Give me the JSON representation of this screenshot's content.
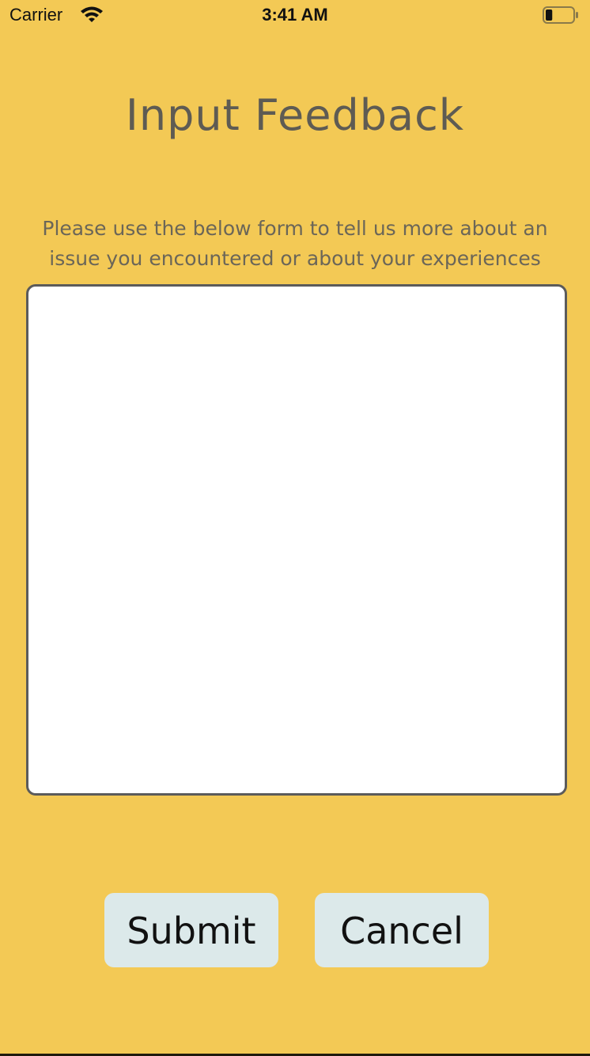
{
  "status_bar": {
    "carrier": "Carrier",
    "time": "3:41 AM",
    "wifi_icon": "wifi-icon",
    "battery_icon": "battery-icon",
    "battery_level": 0.25
  },
  "screen": {
    "title": "Input Feedback",
    "instructions": "Please use the below form to tell us more about an issue you encountered or about your experiences",
    "feedback_value": "",
    "feedback_placeholder": ""
  },
  "buttons": {
    "submit_label": "Submit",
    "cancel_label": "Cancel"
  },
  "colors": {
    "background": "#F3C955",
    "title_text": "#5E5B53",
    "button_bg": "#DCE9EA",
    "textarea_border": "#5B5B5B"
  }
}
